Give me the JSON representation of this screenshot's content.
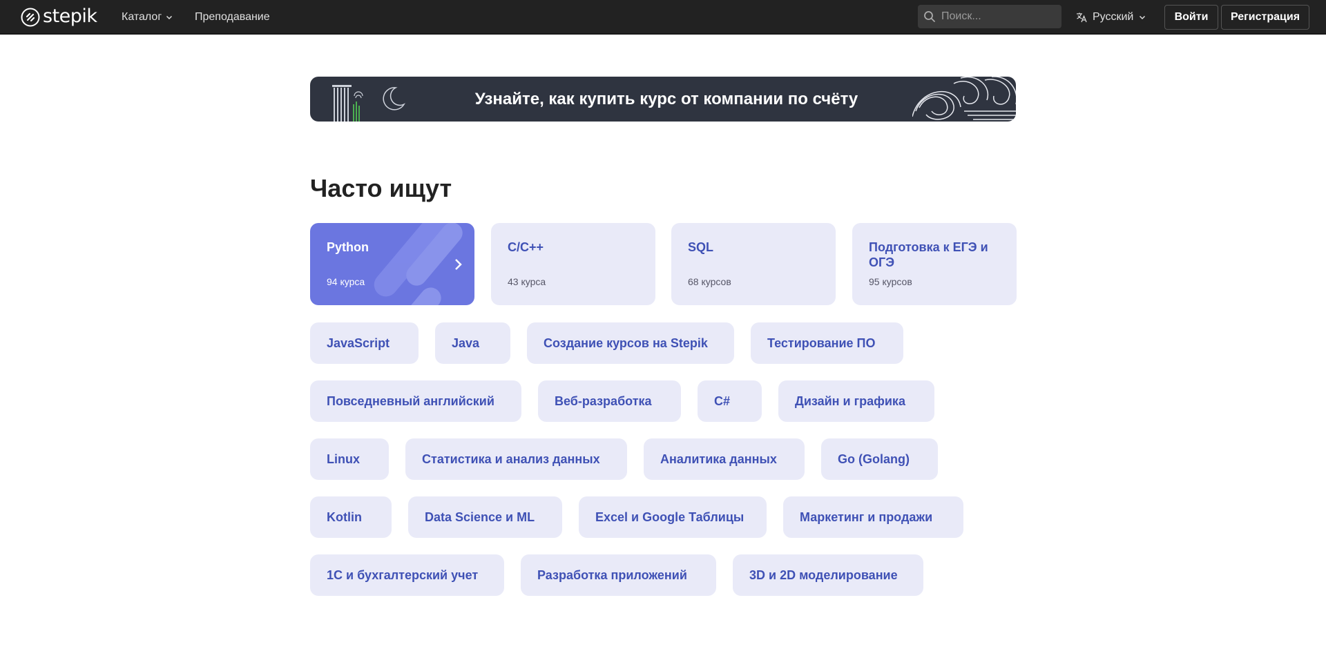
{
  "navbar": {
    "logo_text": "stepik",
    "catalog_label": "Каталог",
    "teaching_label": "Преподавание",
    "search_placeholder": "Поиск...",
    "language_label": "Русский",
    "login_label": "Войти",
    "register_label": "Регистрация"
  },
  "banner": {
    "text": "Узнайте, как купить курс от компании по счёту"
  },
  "popular": {
    "title": "Часто ищут",
    "cards": [
      {
        "name": "Python",
        "count": "94 курса"
      },
      {
        "name": "C/C++",
        "count": "43 курса"
      },
      {
        "name": "SQL",
        "count": "68 курсов"
      },
      {
        "name": "Подготовка к ЕГЭ и ОГЭ",
        "count": "95 курсов"
      }
    ],
    "tags": [
      "JavaScript",
      "Java",
      "Создание курсов на Stepik",
      "Тестирование ПО",
      "Повседневный английский",
      "Веб-разработка",
      "C#",
      "Дизайн и графика",
      "Linux",
      "Статистика и анализ данных",
      "Аналитика данных",
      "Go (Golang)",
      "Kotlin",
      "Data Science и ML",
      "Excel и Google Таблицы",
      "Маркетинг и продажи",
      "1С и бухгалтерский учет",
      "Разработка приложений",
      "3D и 2D моделирование"
    ]
  },
  "colors": {
    "navbar_bg": "#222222",
    "accent": "#3f51b5",
    "card_bg": "#e9eaf8",
    "active_card_bg": "#6b76e0"
  }
}
